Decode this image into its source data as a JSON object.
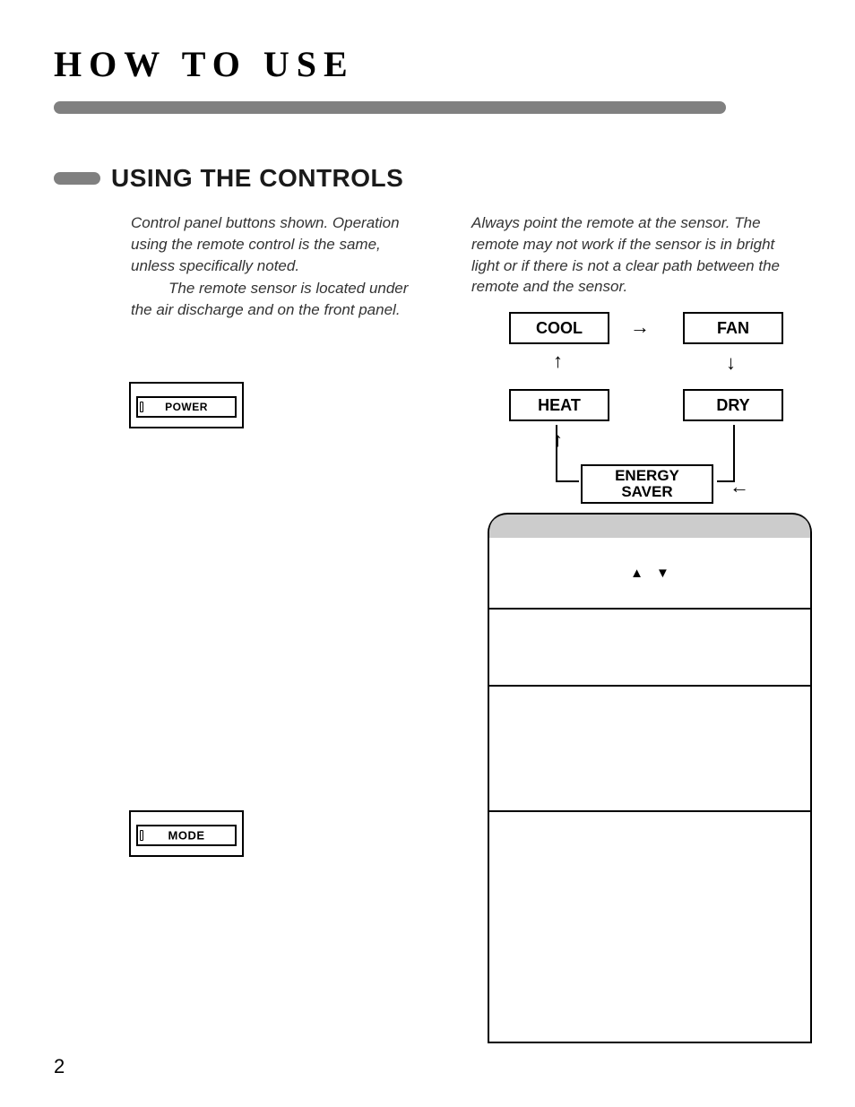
{
  "header": {
    "page_title": "HOW TO USE"
  },
  "section": {
    "title": "USING THE CONTROLS",
    "intro_left_p1": "Control panel buttons shown. Operation using the remote control is the same, unless specifically noted.",
    "intro_left_p2": "The remote sensor is located under the air discharge and on the front panel.",
    "intro_right": "Always point the remote at the sensor. The remote may not work if the sensor is in bright light or if there is not a clear path between the remote and the sensor."
  },
  "buttons": {
    "power": "POWER",
    "mode": "MODE"
  },
  "mode_diagram": {
    "cool": "COOL",
    "fan": "FAN",
    "heat": "HEAT",
    "dry": "DRY",
    "energy_saver_l1": "ENERGY",
    "energy_saver_l2": "SAVER"
  },
  "panel": {
    "up": "▲",
    "down": "▼"
  },
  "footer": {
    "page_number": "2"
  }
}
